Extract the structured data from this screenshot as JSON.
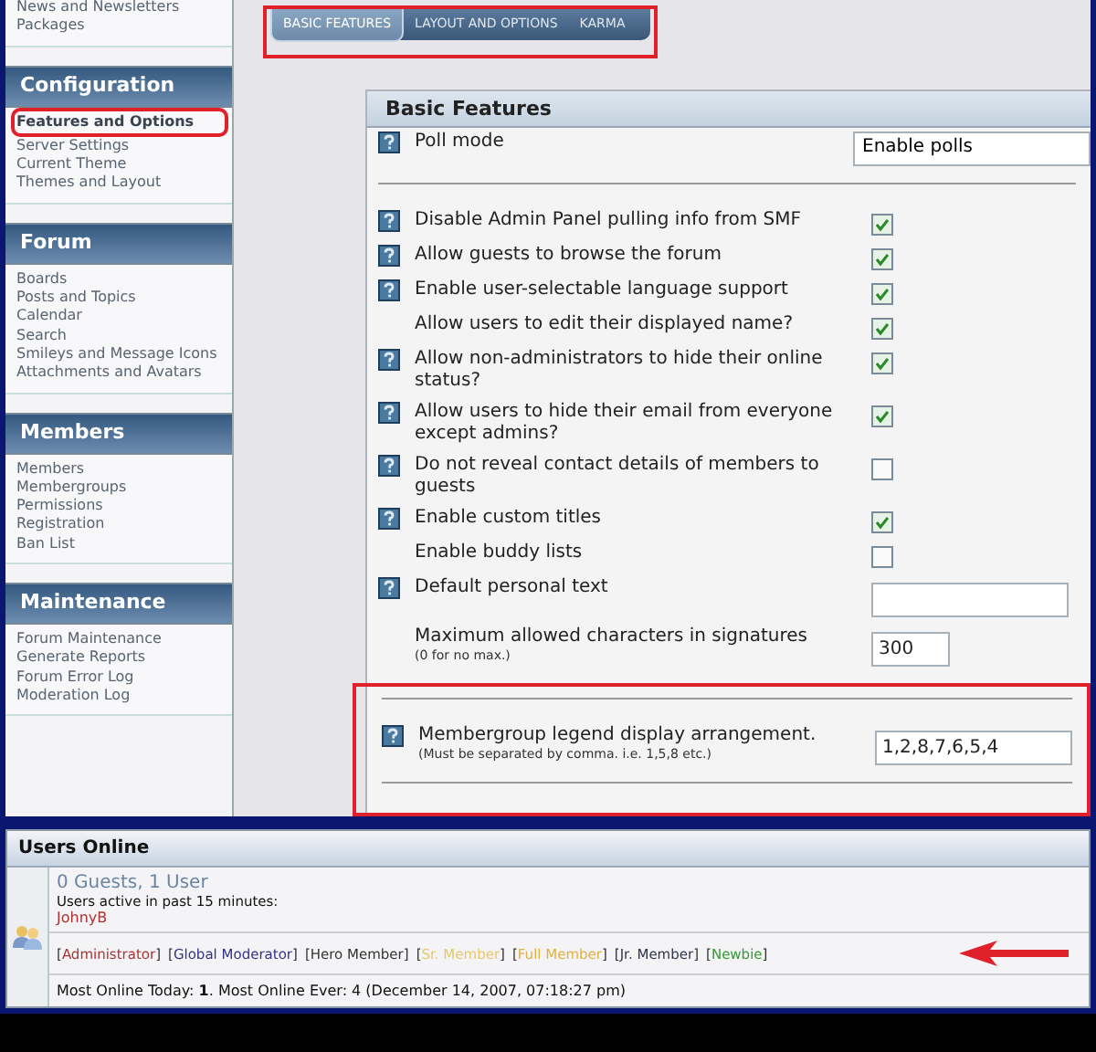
{
  "sidebar": {
    "sections": [
      {
        "items": [
          {
            "label": "News and Newsletters",
            "selected": false,
            "highlighted": false
          },
          {
            "label": "Packages",
            "selected": false,
            "highlighted": false
          }
        ]
      },
      {
        "title": "Configuration",
        "items": [
          {
            "label": "Features and Options",
            "selected": true,
            "highlighted": true
          },
          {
            "label": "Server Settings",
            "selected": false,
            "highlighted": false
          },
          {
            "label": "Current Theme",
            "selected": false,
            "highlighted": false
          },
          {
            "label": "Themes and Layout",
            "selected": false,
            "highlighted": false
          }
        ]
      },
      {
        "title": "Forum",
        "items": [
          {
            "label": "Boards",
            "selected": false,
            "highlighted": false
          },
          {
            "label": "Posts and Topics",
            "selected": false,
            "highlighted": false
          },
          {
            "label": "Calendar",
            "selected": false,
            "highlighted": false
          },
          {
            "label": "Search",
            "selected": false,
            "highlighted": false
          },
          {
            "label": "Smileys and Message Icons",
            "selected": false,
            "highlighted": false
          },
          {
            "label": "Attachments and Avatars",
            "selected": false,
            "highlighted": false
          }
        ]
      },
      {
        "title": "Members",
        "items": [
          {
            "label": "Members",
            "selected": false,
            "highlighted": false
          },
          {
            "label": "Membergroups",
            "selected": false,
            "highlighted": false
          },
          {
            "label": "Permissions",
            "selected": false,
            "highlighted": false
          },
          {
            "label": "Registration",
            "selected": false,
            "highlighted": false
          },
          {
            "label": "Ban List",
            "selected": false,
            "highlighted": false
          }
        ]
      },
      {
        "title": "Maintenance",
        "items": [
          {
            "label": "Forum Maintenance",
            "selected": false,
            "highlighted": false
          },
          {
            "label": "Generate Reports",
            "selected": false,
            "highlighted": false
          },
          {
            "label": "Forum Error Log",
            "selected": false,
            "highlighted": false
          },
          {
            "label": "Moderation Log",
            "selected": false,
            "highlighted": false
          }
        ]
      }
    ]
  },
  "tabs": {
    "highlighted": true,
    "items": [
      {
        "label": "BASIC FEATURES",
        "selected": true
      },
      {
        "label": "LAYOUT AND OPTIONS",
        "selected": false
      },
      {
        "label": "KARMA",
        "selected": false
      }
    ]
  },
  "settings": {
    "title": "Basic Features",
    "rows": [
      {
        "kind": "select",
        "help": true,
        "label": "Poll mode",
        "value": "Enable polls"
      },
      {
        "kind": "divider"
      },
      {
        "kind": "checkbox",
        "help": true,
        "label": "Disable Admin Panel pulling info from SMF",
        "checked": true
      },
      {
        "kind": "checkbox",
        "help": true,
        "label": "Allow guests to browse the forum",
        "checked": true
      },
      {
        "kind": "checkbox",
        "help": true,
        "label": "Enable user-selectable language support",
        "checked": true
      },
      {
        "kind": "checkbox",
        "help": false,
        "label": "Allow users to edit their displayed name?",
        "checked": true
      },
      {
        "kind": "checkbox",
        "help": true,
        "label": "Allow non-administrators to hide their online status?",
        "checked": true
      },
      {
        "kind": "checkbox",
        "help": true,
        "label": "Allow users to hide their email from everyone except admins?",
        "checked": true
      },
      {
        "kind": "checkbox",
        "help": true,
        "label": "Do not reveal contact details of members to guests",
        "checked": false
      },
      {
        "kind": "checkbox",
        "help": true,
        "label": "Enable custom titles",
        "checked": true
      },
      {
        "kind": "checkbox",
        "help": false,
        "label": "Enable buddy lists",
        "checked": false
      },
      {
        "kind": "text",
        "help": true,
        "label": "Default personal text"
      },
      {
        "kind": "number",
        "help": false,
        "label": "Maximum allowed characters in signatures",
        "note": "(0 for no max.)",
        "value": "300"
      },
      {
        "kind": "section",
        "highlighted": true,
        "rows": [
          {
            "kind": "text",
            "help": true,
            "label": "Membergroup legend display arrangement.",
            "note": "(Must be separated by comma. i.e. 1,5,8 etc.)",
            "value": "1,2,8,7,6,5,4"
          }
        ]
      }
    ]
  },
  "users_online": {
    "title": "Users Online",
    "count": "0 Guests, 1 User",
    "active_label": "Users active in past 15 minutes:",
    "users": [
      {
        "name": "JohnyB",
        "color": "#aa3333"
      }
    ],
    "legend": [
      {
        "name": "[Administrator]",
        "color": "#aa3333"
      },
      {
        "name": "[Global Moderator]",
        "color": "#333388"
      },
      {
        "name": "[Hero Member]",
        "color": "#333333"
      },
      {
        "name": "[Sr. Member]",
        "color": "#e8c86a"
      },
      {
        "name": "[Full Member]",
        "color": "#e0b040"
      },
      {
        "name": "[Jr. Member]",
        "color": "#33334a"
      },
      {
        "name": "[Newbie]",
        "color": "#339933"
      }
    ],
    "legend_arrow": true,
    "stats": "Most Online Today: **1**. Most Online Ever: 4 (December 14, 2007, 07:18:27 pm)"
  }
}
